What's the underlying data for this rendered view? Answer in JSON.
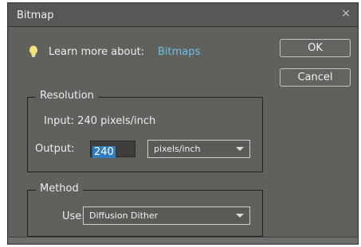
{
  "window": {
    "title": "Bitmap",
    "close_glyph": "×"
  },
  "help": {
    "icon": "lightbulb-icon",
    "text": "Learn more about:",
    "link": "Bitmaps",
    "link_color": "#6ec2e6"
  },
  "buttons": {
    "ok": "OK",
    "cancel": "Cancel"
  },
  "resolution": {
    "legend": "Resolution",
    "input_text": "Input:  240 pixels/inch",
    "output_label": "Output:",
    "output_value": "240",
    "units_selected": "pixels/inch"
  },
  "method": {
    "legend": "Method",
    "use_label": "Use:",
    "selected": "Diffusion Dither"
  },
  "colors": {
    "dialog_bg": "#60615d",
    "titlebar_bg": "#575755",
    "selection": "#2f7ec4"
  }
}
